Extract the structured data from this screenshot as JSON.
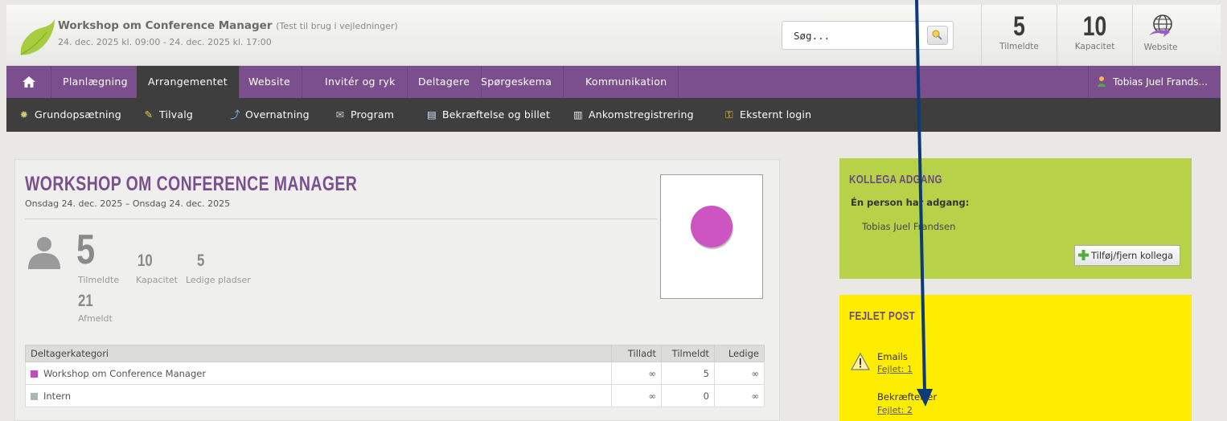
{
  "header": {
    "title": "Workshop om Conference Manager",
    "subtitle": "(Test til brug i vejledninger)",
    "dates": "24. dec. 2025 kl. 09:00 - 24. dec. 2025 kl. 17:00",
    "search_placeholder": "Søg...",
    "stats": [
      {
        "value": "5",
        "label": "Tilmeldte"
      },
      {
        "value": "10",
        "label": "Kapacitet"
      }
    ],
    "website_label": "Website"
  },
  "main_nav": {
    "home_icon": "home-icon",
    "items": [
      "Planlægning",
      "Arrangementet",
      "Website",
      "Invitér og ryk",
      "Deltagere",
      "Spørgeskema",
      "Kommunikation"
    ],
    "active": "Arrangementet",
    "user": "Tobias Juel Frands..."
  },
  "sub_nav": {
    "items": [
      {
        "label": "Grundopsætning",
        "icon": "gear-icon"
      },
      {
        "label": "Tilvalg",
        "icon": "pencil-icon"
      },
      {
        "label": "Overnatning",
        "icon": "bed-icon"
      },
      {
        "label": "Program",
        "icon": "program-icon"
      },
      {
        "label": "Bekræftelse og billet",
        "icon": "document-icon"
      },
      {
        "label": "Ankomstregistrering",
        "icon": "barcode-icon"
      },
      {
        "label": "Eksternt login",
        "icon": "key-icon"
      }
    ]
  },
  "event": {
    "title": "WORKSHOP OM CONFERENCE MANAGER",
    "dates": "Onsdag 24. dec. 2025 – Onsdag 24. dec. 2025",
    "registered": {
      "value": "5",
      "label": "Tilmeldte"
    },
    "capacity": {
      "value": "10",
      "label": "Kapacitet"
    },
    "free": {
      "value": "5",
      "label": "Ledige pladser"
    },
    "cancelled": {
      "value": "21",
      "label": "Afmeldt"
    },
    "preview_color": "#cc55c1"
  },
  "categories_table": {
    "headers": [
      "Deltagerkategori",
      "Tilladt",
      "Tilmeldt",
      "Ledige"
    ],
    "rows": [
      {
        "name": "Workshop om Conference Manager",
        "color": "#c04dbd",
        "allowed": "∞",
        "registered": "5",
        "free": "∞"
      },
      {
        "name": "Intern",
        "color": "#aab5b5",
        "allowed": "∞",
        "registered": "0",
        "free": "∞"
      }
    ]
  },
  "colleague_box": {
    "title": "KOLLEGA ADGANG",
    "subtitle": "Én person har adgang:",
    "person": "Tobias Juel Frandsen",
    "button": "Tilføj/fjern kollega",
    "color": "#b7d248"
  },
  "failed_box": {
    "title": "FEJLET POST",
    "items": [
      {
        "label": "Emails",
        "link": "Fejlet: 1"
      },
      {
        "label": "Bekræftelser",
        "link": "Fejlet: 2"
      }
    ],
    "color": "#ffed00"
  },
  "annotation_arrow_color": "#0d3a78"
}
